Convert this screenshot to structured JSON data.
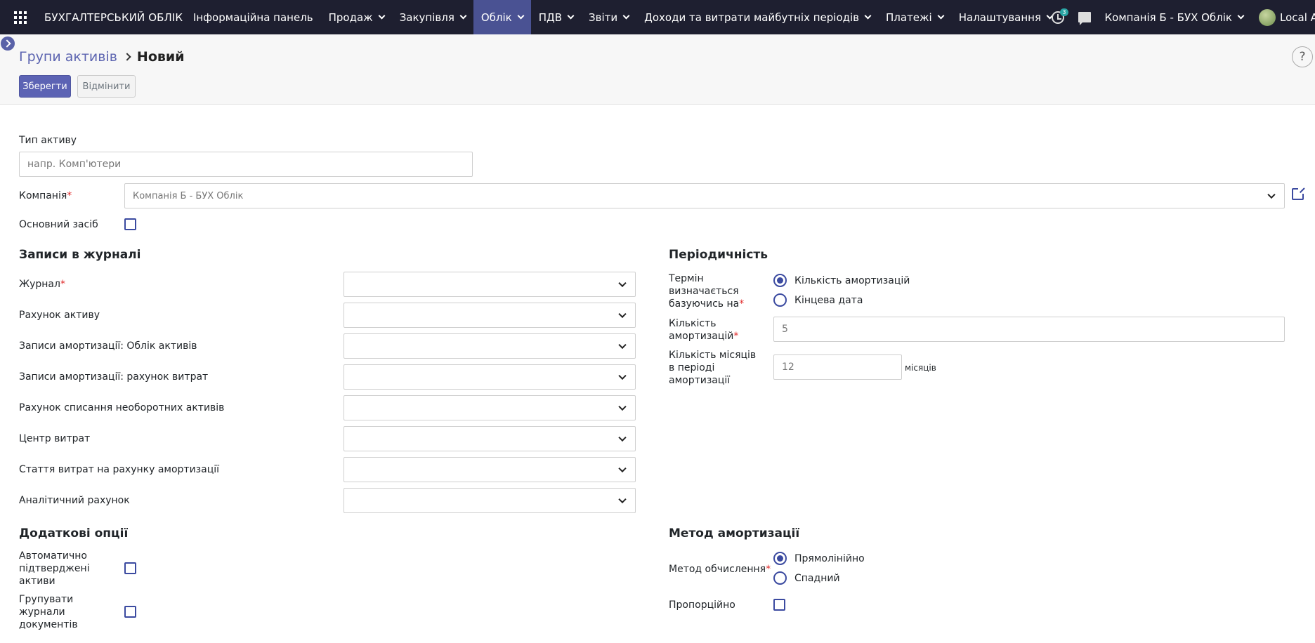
{
  "nav": {
    "brand": "БУХГАЛТЕРСЬКИЙ ОБЛІК",
    "items": [
      {
        "label": "Інформаційна панель",
        "dropdown": false
      },
      {
        "label": "Продаж",
        "dropdown": true
      },
      {
        "label": "Закупівля",
        "dropdown": true
      },
      {
        "label": "Облік",
        "dropdown": true,
        "active": true
      },
      {
        "label": "ПДВ",
        "dropdown": true
      },
      {
        "label": "Звіти",
        "dropdown": true
      },
      {
        "label": "Доходи та витрати майбутніх періодів",
        "dropdown": true
      },
      {
        "label": "Платежі",
        "dropdown": true
      },
      {
        "label": "Налаштування",
        "dropdown": true
      }
    ],
    "activity_badge": "3",
    "company": "Компанія Б - БУХ Облік",
    "user": "Local Admin"
  },
  "breadcrumb": {
    "parent": "Групи активів",
    "current": "Новий"
  },
  "buttons": {
    "save": "Зберегти",
    "discard": "Відмінити",
    "help": "?"
  },
  "form": {
    "asset_type_label": "Тип активу",
    "asset_type_placeholder": "напр. Комп'ютери",
    "company_label": "Компанія",
    "company_value": "Компанія Б - БУХ Облік",
    "fixed_asset_label": "Основний засіб",
    "journal_section": {
      "title": "Записи в журналі",
      "fields": [
        {
          "label": "Журнал",
          "required": true
        },
        {
          "label": "Рахунок активу",
          "required": false
        },
        {
          "label": "Записи амортизації: Облік активів",
          "required": false
        },
        {
          "label": "Записи амортизації: рахунок витрат",
          "required": false
        },
        {
          "label": "Рахунок списання необоротних активів",
          "required": false
        },
        {
          "label": "Центр витрат",
          "required": false
        },
        {
          "label": "Стаття витрат на рахунку амортизації",
          "required": false
        },
        {
          "label": "Аналітичний рахунок",
          "required": false
        }
      ]
    },
    "periodicity": {
      "title": "Періодичність",
      "term_label": "Термін визначається базуючись на",
      "term_options": [
        {
          "label": "Кількість амортизацій",
          "selected": true
        },
        {
          "label": "Кінцева дата",
          "selected": false
        }
      ],
      "count_label": "Кількість амортизацій",
      "count_value": "5",
      "months_label": "Кількість місяців в періоді амортизації",
      "months_value": "12",
      "months_unit": "місяців"
    },
    "extra_options": {
      "title": "Додаткові опції",
      "auto_confirm_label": "Автоматично підтверджені активи",
      "group_entries_label": "Групувати журнали документів"
    },
    "method": {
      "title": "Метод амортизації",
      "calc_label": "Метод обчислення",
      "calc_options": [
        {
          "label": "Прямолінійно",
          "selected": true
        },
        {
          "label": "Спадний",
          "selected": false
        }
      ],
      "prorata_label": "Пропорційно"
    }
  },
  "colors": {
    "navbar": "#1e1f30",
    "active_menu": "#4a5293",
    "primary": "#5c63b4",
    "link": "#5c64b0",
    "required": "#e02c2c"
  }
}
